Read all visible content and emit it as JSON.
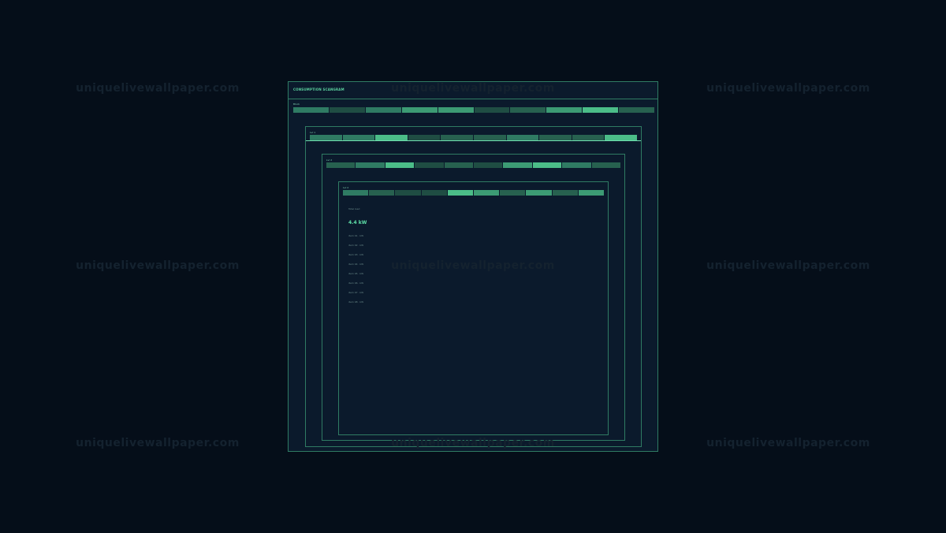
{
  "watermark": "uniquelivewallpaper.com",
  "window": {
    "title": "CONSUMPTION SCANGRAM"
  },
  "levels": [
    {
      "label": "Block",
      "segments": [
        2,
        0,
        2,
        3,
        3,
        0,
        1,
        3,
        4,
        1
      ]
    },
    {
      "label": "Lvl 1",
      "segments": [
        2,
        2,
        4,
        0,
        1,
        1,
        2,
        1,
        1,
        4
      ]
    },
    {
      "label": "Lvl 2",
      "segments": [
        1,
        2,
        4,
        0,
        1,
        0,
        3,
        4,
        2,
        1
      ]
    },
    {
      "label": "Lvl 3",
      "segments": [
        2,
        1,
        0,
        0,
        4,
        3,
        1,
        3,
        1,
        3
      ]
    }
  ],
  "detail": {
    "header": "Total load",
    "value": "4.4 kW",
    "rows": [
      "item 01 · kW",
      "item 02 · kW",
      "item 03 · kW",
      "item 04 · kW",
      "item 05 · kW",
      "item 06 · kW",
      "item 07 · kW",
      "item 08 · kW"
    ]
  },
  "colors": {
    "background": "#050e19",
    "panel": "#0b1a2c",
    "border": "#2f7b63",
    "accent": "#5ee0a8"
  }
}
